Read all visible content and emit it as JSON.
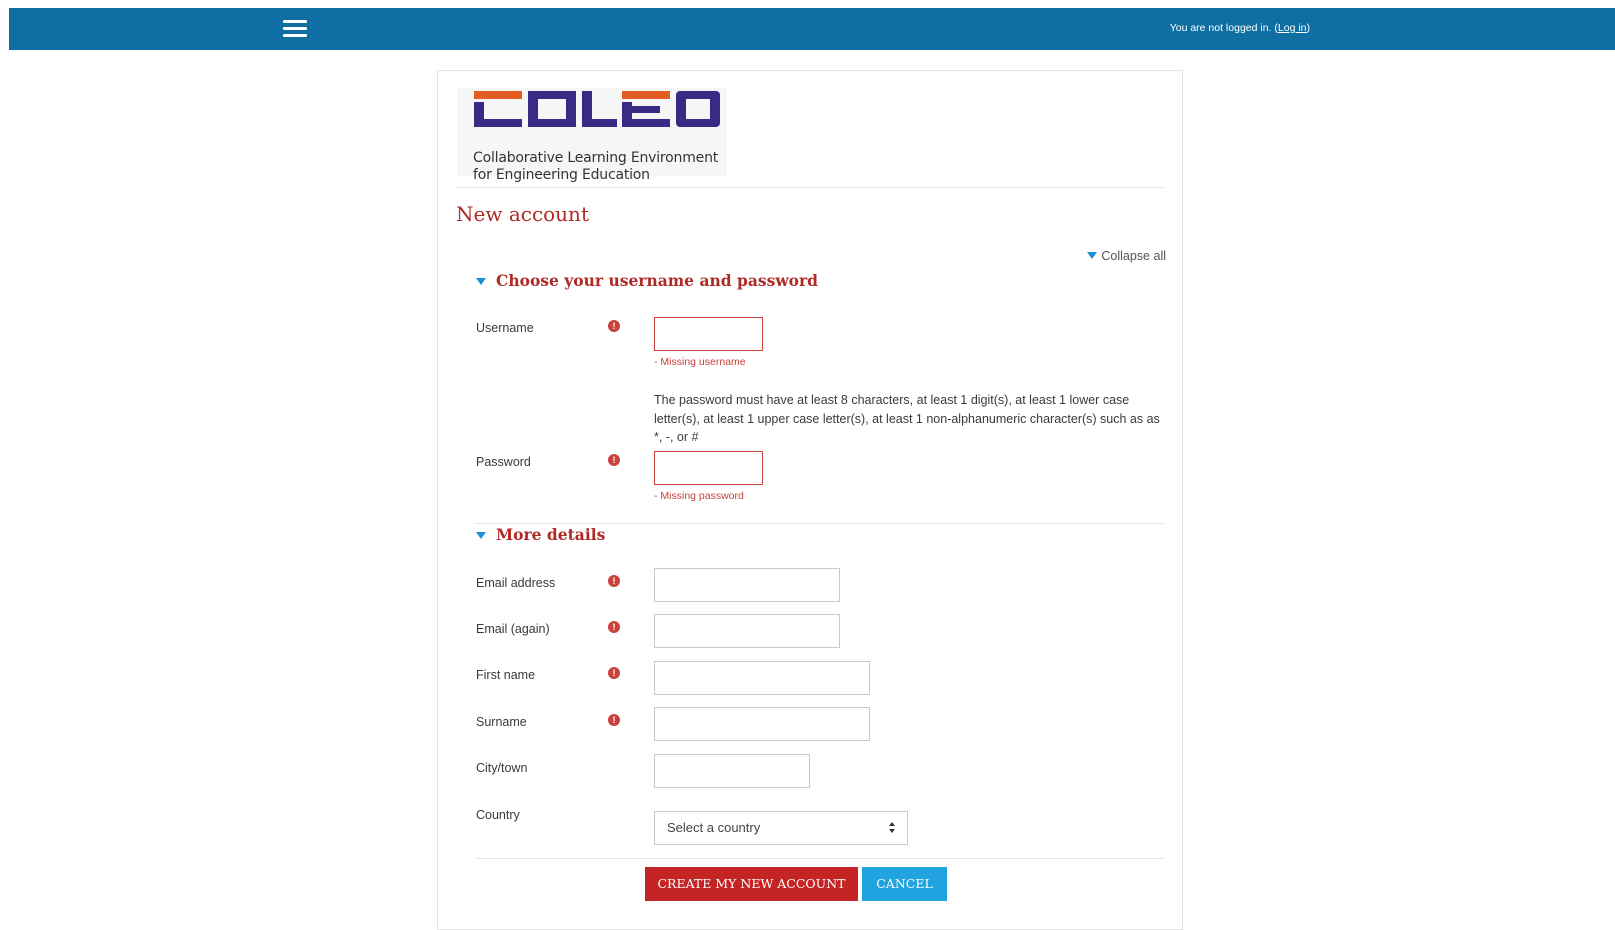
{
  "header": {
    "login_text": "You are not logged in. (",
    "login_link": "Log in",
    "login_suffix": ")",
    "bar_color": "#0f6fa3",
    "menu_icon": "hamburger-menu-icon"
  },
  "logo": {
    "wordmark": "COLED",
    "line1": "Collaborative Learning Environment",
    "line2": "for Engineering Education",
    "orange": "#e35d24",
    "purple": "#3b2a85"
  },
  "page": {
    "title": "New account",
    "collapse_all": "Collapse all"
  },
  "sections": {
    "credentials": {
      "title": "Choose your username and password",
      "username_label": "Username",
      "username_value": "",
      "username_error": "- Missing username",
      "password_help": "The password must have at least 8 characters, at least 1 digit(s), at least 1 lower case letter(s), at least 1 upper case letter(s), at least 1 non-alphanumeric character(s) such as as *, -, or #",
      "password_label": "Password",
      "password_value": "",
      "password_error": "- Missing password"
    },
    "details": {
      "title": "More details",
      "email_label": "Email address",
      "email_value": "",
      "email_again_label": "Email (again)",
      "email_again_value": "",
      "firstname_label": "First name",
      "firstname_value": "",
      "surname_label": "Surname",
      "surname_value": "",
      "city_label": "City/town",
      "city_value": "",
      "country_label": "Country",
      "country_selected": "Select a country"
    }
  },
  "buttons": {
    "create": "CREATE MY NEW ACCOUNT",
    "cancel": "CANCEL"
  },
  "required_icon": "!",
  "colors": {
    "heading": "#b02a26",
    "error": "#c9423c",
    "primary_button": "#c42424",
    "cancel_button": "#21a3e0",
    "accent_triangle": "#1a8fd6"
  }
}
